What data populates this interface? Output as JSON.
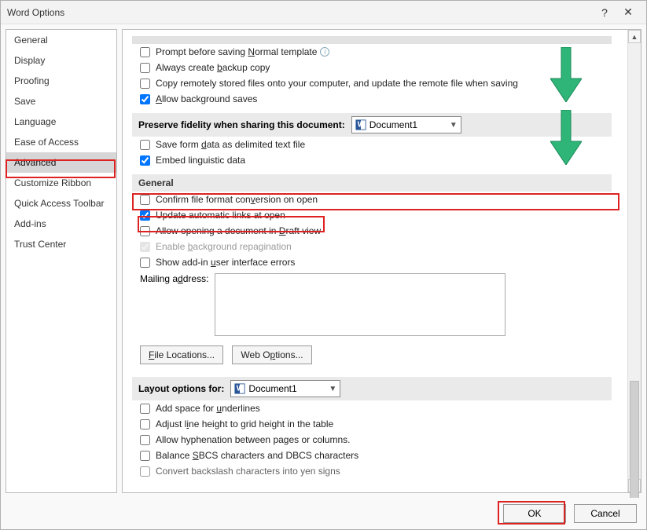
{
  "title": "Word Options",
  "sidebar": {
    "items": [
      {
        "label": "General"
      },
      {
        "label": "Display"
      },
      {
        "label": "Proofing"
      },
      {
        "label": "Save"
      },
      {
        "label": "Language"
      },
      {
        "label": "Ease of Access"
      },
      {
        "label": "Advanced"
      },
      {
        "label": "Customize Ribbon"
      },
      {
        "label": "Quick Access Toolbar"
      },
      {
        "label": "Add-ins"
      },
      {
        "label": "Trust Center"
      }
    ],
    "selected": "Advanced"
  },
  "save_section": {
    "opts": {
      "prompt_normal": "Prompt before saving Normal template",
      "backup": "Always create backup copy",
      "copy_remote": "Copy remotely stored files onto your computer, and update the remote file when saving",
      "allow_bg": "Allow background saves"
    }
  },
  "preserve": {
    "label": "Preserve fidelity when sharing this document:",
    "doc": "Document1",
    "opts": {
      "save_form": "Save form data as delimited text file",
      "embed_ling": "Embed linguistic data"
    }
  },
  "general": {
    "title": "General",
    "opts": {
      "confirm_conv": "Confirm file format conversion on open",
      "update_links": "Update automatic links at open",
      "allow_draft": "Allow opening a document in Draft view",
      "enable_bg_repag": "Enable background repagination",
      "show_addin_err": "Show add-in user interface errors"
    },
    "mailing_label": "Mailing address:",
    "file_locations": "File Locations...",
    "web_options": "Web Options..."
  },
  "layout": {
    "label": "Layout options for:",
    "doc": "Document1",
    "opts": {
      "add_space": "Add space for underlines",
      "adjust_line": "Adjust line height to grid height in the table",
      "allow_hyph": "Allow hyphenation between pages or columns.",
      "balance_sbcs": "Balance SBCS characters and DBCS characters",
      "convert_yen": "Convert backslash characters into yen signs"
    }
  },
  "footer": {
    "ok": "OK",
    "cancel": "Cancel"
  },
  "icons": {
    "help": "?",
    "close": "✕"
  }
}
